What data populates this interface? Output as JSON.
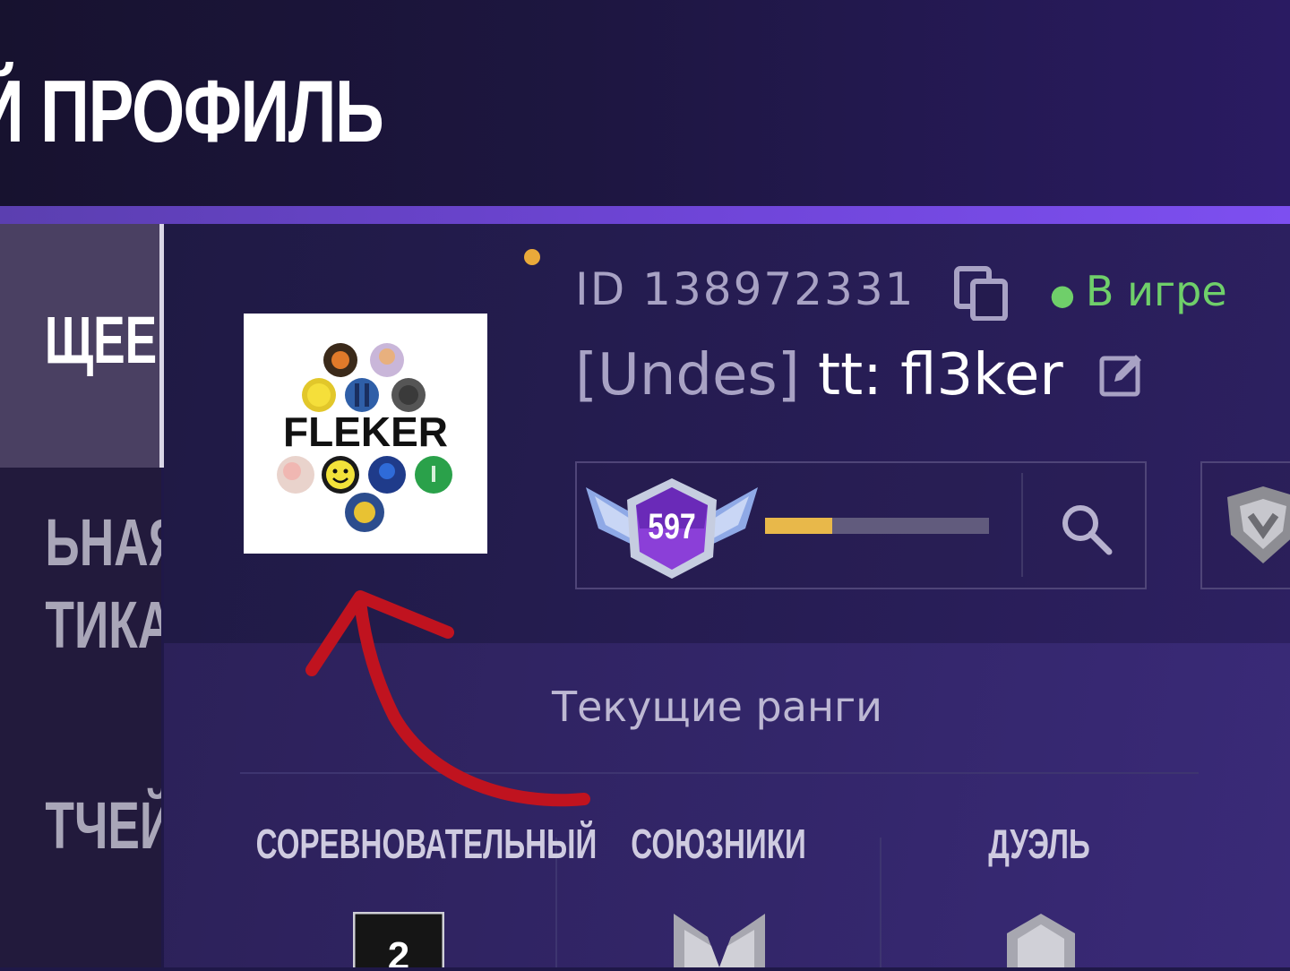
{
  "header": {
    "title": "Й ПРОФИЛЬ"
  },
  "sidebar": {
    "items": [
      {
        "lines": [
          "ЩЕЕ"
        ],
        "active": true
      },
      {
        "lines": [
          "ЬНАЯ",
          "ТИКА"
        ],
        "active": false
      },
      {
        "lines": [
          "ТЧЕЙ"
        ],
        "active": false
      }
    ]
  },
  "profile": {
    "avatar_text": "FLEKER",
    "id_text": "ID 138972331",
    "status": "В игре",
    "clan_tag": "[Undes]",
    "nickname": "tt: fl3ker",
    "level": "597",
    "level_progress": 0.3,
    "icons": [
      "copy-icon",
      "edit-icon",
      "search-icon",
      "level-badge",
      "rank-emblem"
    ],
    "colors": {
      "status_online": "#6fcf6a",
      "xp_fill": "#e8b84a",
      "accent": "#6f45d8",
      "annotation_arrow": "#c0131f"
    }
  },
  "ranks": {
    "title": "Текущие ранги",
    "modes": [
      {
        "label": "СОРЕВНОВАТЕЛЬНЫЙ",
        "rank": "2"
      },
      {
        "label": "СОЮЗНИКИ",
        "rank": ""
      },
      {
        "label": "ДУЭЛЬ",
        "rank": ""
      }
    ]
  }
}
